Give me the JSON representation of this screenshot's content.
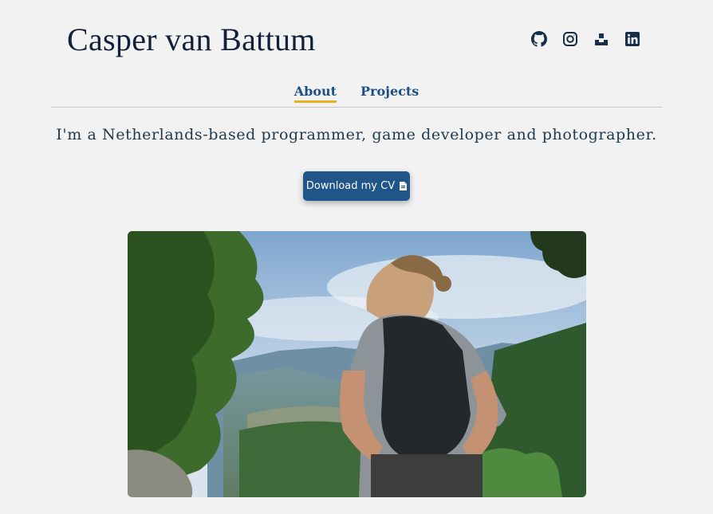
{
  "header": {
    "site_title": "Casper van Battum"
  },
  "social_links": [
    {
      "name": "github",
      "icon": "github-icon"
    },
    {
      "name": "instagram",
      "icon": "instagram-icon"
    },
    {
      "name": "itch",
      "icon": "itch-icon"
    },
    {
      "name": "linkedin",
      "icon": "linkedin-icon"
    }
  ],
  "nav": {
    "items": [
      {
        "label": "About",
        "active": true
      },
      {
        "label": "Projects",
        "active": false
      }
    ]
  },
  "main": {
    "tagline": "I'm a Netherlands-based programmer, game developer and photographer.",
    "cv_button_label": "Download my CV",
    "cv_button_icon": "file-icon"
  },
  "colors": {
    "accent": "#1f5589",
    "nav_underline": "#e8b024",
    "text_dark": "#13203a",
    "background": "#f2f2f2"
  }
}
